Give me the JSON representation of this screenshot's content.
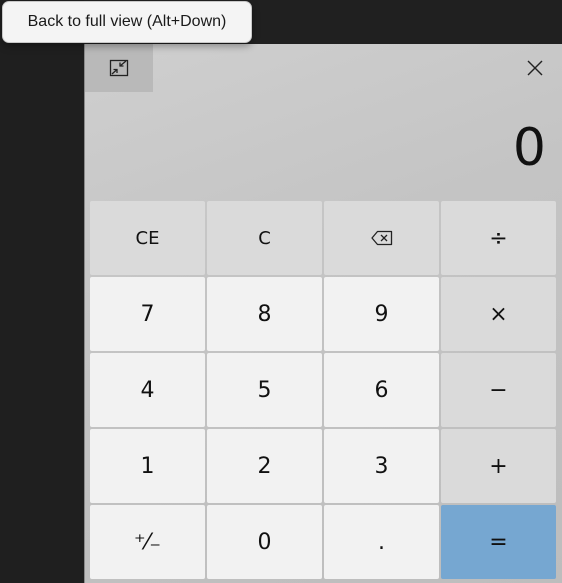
{
  "tooltip": {
    "text": "Back to full view (Alt+Down)"
  },
  "titlebar": {
    "back_icon": "restore-full-view-icon",
    "close_icon": "close-icon"
  },
  "display": {
    "value": "0"
  },
  "keys": {
    "ce": "CE",
    "c": "C",
    "backspace_icon": "backspace-icon",
    "divide": "÷",
    "seven": "7",
    "eight": "8",
    "nine": "9",
    "multiply": "×",
    "four": "4",
    "five": "5",
    "six": "6",
    "subtract": "−",
    "one": "1",
    "two": "2",
    "three": "3",
    "add": "+",
    "negate": "⁺⁄₋",
    "zero": "0",
    "decimal": ".",
    "equals": "="
  },
  "colors": {
    "equals_key": "#76a7d1",
    "number_key": "#f2f2f2",
    "operator_key": "#dadada"
  }
}
